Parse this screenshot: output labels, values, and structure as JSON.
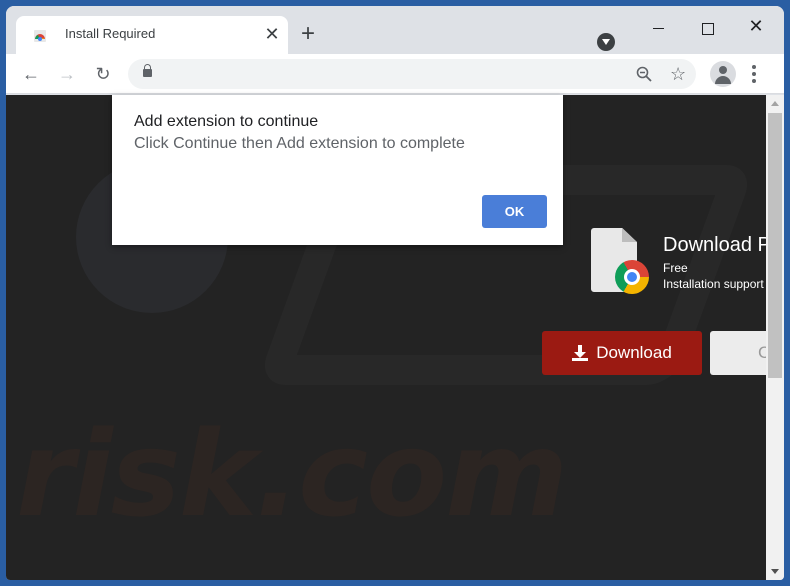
{
  "browser": {
    "tab": {
      "title": "Install Required",
      "close_glyph": "✕"
    },
    "new_tab_glyph": "+",
    "window_controls": {
      "close_glyph": "✕"
    },
    "toolbar": {
      "back_glyph": "←",
      "forward_glyph": "→",
      "reload_glyph": "↻",
      "address": "",
      "star_glyph": "☆"
    }
  },
  "page": {
    "watermark": "risk.com",
    "product": {
      "title": "Download P",
      "price": "Free",
      "support": "Installation support"
    },
    "buttons": {
      "download": "Download",
      "secondary": "C"
    }
  },
  "dialog": {
    "title": "Add extension to continue",
    "message": "Click Continue then Add extension to complete",
    "ok_label": "OK"
  },
  "colors": {
    "download_button": "#9b1a12",
    "ok_button": "#4a7ed8",
    "page_background": "#232323"
  }
}
